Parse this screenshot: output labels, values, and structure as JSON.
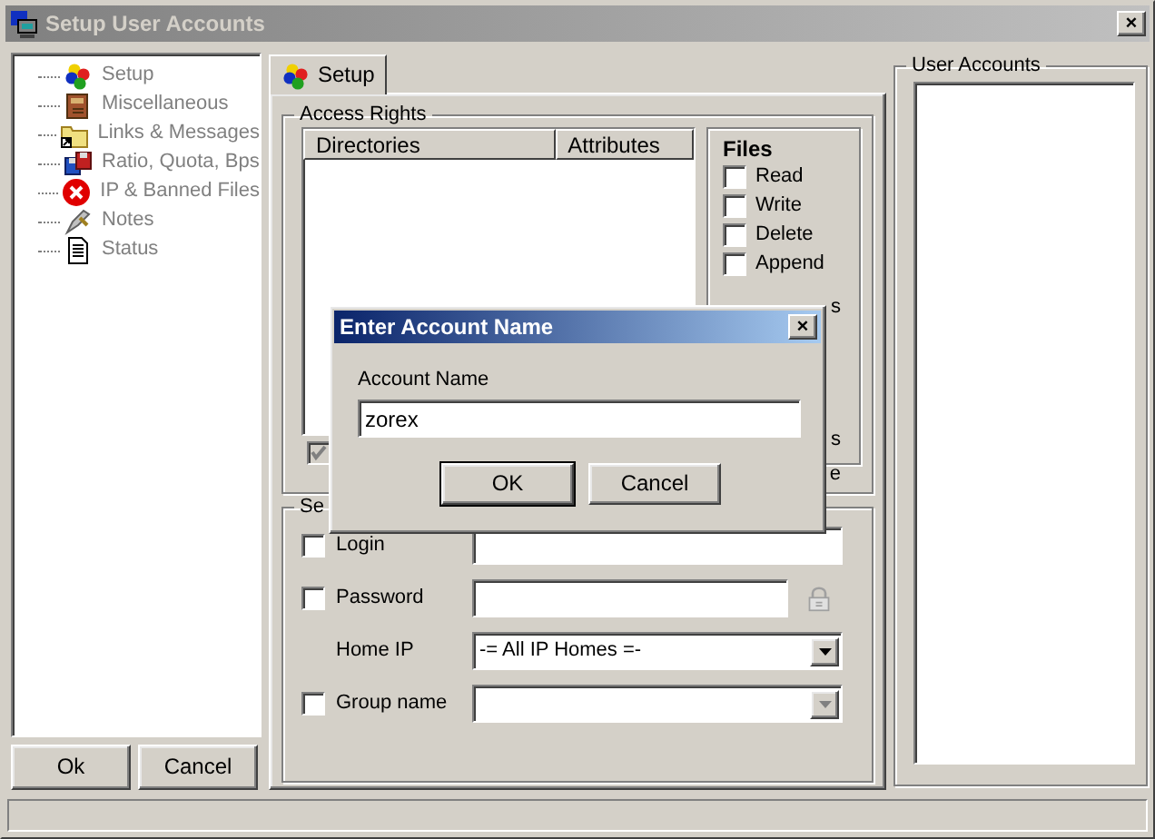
{
  "window": {
    "title": "Setup User Accounts",
    "close": "×"
  },
  "tree": {
    "items": [
      {
        "label": "Setup",
        "disabled": true
      },
      {
        "label": "Miscellaneous",
        "disabled": true
      },
      {
        "label": "Links & Messages",
        "disabled": true
      },
      {
        "label": "Ratio, Quota, Bps",
        "disabled": true
      },
      {
        "label": "IP & Banned Files",
        "disabled": true
      },
      {
        "label": "Notes",
        "disabled": true
      },
      {
        "label": "Status",
        "disabled": true
      }
    ]
  },
  "left_buttons": [
    {
      "label": "Ok"
    },
    {
      "label": "Cancel"
    }
  ],
  "tabs": [
    {
      "label": "Setup",
      "selected": true
    }
  ],
  "access_rights": {
    "title": "Access Rights",
    "columns": [
      "Directories",
      "Attributes"
    ],
    "inherit_checkbox": {
      "checked": true,
      "disabled": true
    },
    "files": {
      "title": "Files",
      "options": [
        {
          "label": "Read",
          "checked": false
        },
        {
          "label": "Write",
          "checked": false
        },
        {
          "label": "Delete",
          "checked": false
        },
        {
          "label": "Append",
          "checked": false
        }
      ],
      "fragments": [
        "s",
        "s",
        "e"
      ]
    }
  },
  "setup": {
    "title": "Se",
    "fields": [
      {
        "kind": "text",
        "label": "Login",
        "checked": false
      },
      {
        "kind": "password",
        "label": "Password",
        "checked": false
      },
      {
        "kind": "select",
        "label": "Home IP",
        "value": "-= All IP Homes =-",
        "disabled": false
      },
      {
        "kind": "select",
        "label": "Group name",
        "checked": false,
        "disabled": true
      }
    ]
  },
  "user_accounts": {
    "title": "User Accounts"
  },
  "dialog": {
    "title": "Enter Account Name",
    "close": "×",
    "label": "Account Name",
    "value": "zorex",
    "buttons": [
      {
        "label": "OK",
        "default": true
      },
      {
        "label": "Cancel",
        "default": false
      }
    ]
  }
}
